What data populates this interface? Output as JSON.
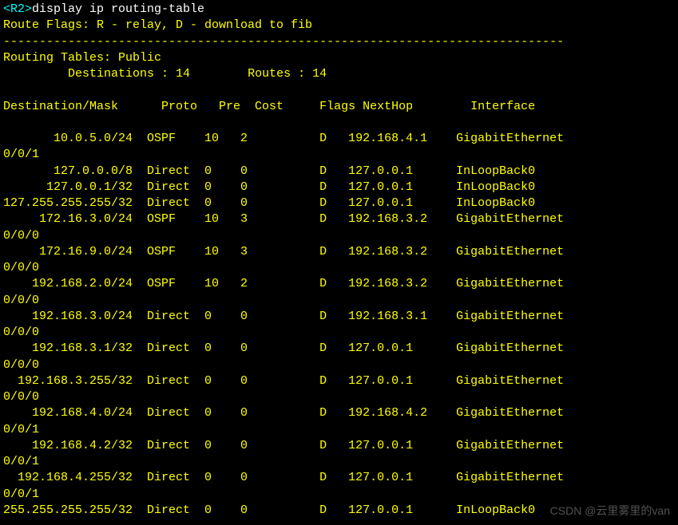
{
  "prompt": {
    "host": "<R2>",
    "command": "display ip routing-table"
  },
  "flags_legend": "Route Flags: R - relay, D - download to fib",
  "divider": "------------------------------------------------------------------------------",
  "table_title": "Routing Tables: Public",
  "summary": {
    "dest_label": "Destinations : ",
    "dest_value": "14",
    "routes_label": "Routes : ",
    "routes_value": "14"
  },
  "headers": {
    "destination": "Destination/Mask",
    "proto": "Proto",
    "pre": "Pre",
    "cost": "Cost",
    "flags": "Flags",
    "nexthop": "NextHop",
    "interface": "Interface"
  },
  "rows": [
    {
      "destination": "10.0.5.0/24",
      "proto": "OSPF",
      "pre": "10",
      "cost": "2",
      "flags": "D",
      "nexthop": "192.168.4.1",
      "interface": "GigabitEthernet",
      "interface_cont": "0/0/1"
    },
    {
      "destination": "127.0.0.0/8",
      "proto": "Direct",
      "pre": "0",
      "cost": "0",
      "flags": "D",
      "nexthop": "127.0.0.1",
      "interface": "InLoopBack0",
      "interface_cont": ""
    },
    {
      "destination": "127.0.0.1/32",
      "proto": "Direct",
      "pre": "0",
      "cost": "0",
      "flags": "D",
      "nexthop": "127.0.0.1",
      "interface": "InLoopBack0",
      "interface_cont": ""
    },
    {
      "destination": "127.255.255.255/32",
      "proto": "Direct",
      "pre": "0",
      "cost": "0",
      "flags": "D",
      "nexthop": "127.0.0.1",
      "interface": "InLoopBack0",
      "interface_cont": ""
    },
    {
      "destination": "172.16.3.0/24",
      "proto": "OSPF",
      "pre": "10",
      "cost": "3",
      "flags": "D",
      "nexthop": "192.168.3.2",
      "interface": "GigabitEthernet",
      "interface_cont": "0/0/0"
    },
    {
      "destination": "172.16.9.0/24",
      "proto": "OSPF",
      "pre": "10",
      "cost": "3",
      "flags": "D",
      "nexthop": "192.168.3.2",
      "interface": "GigabitEthernet",
      "interface_cont": "0/0/0"
    },
    {
      "destination": "192.168.2.0/24",
      "proto": "OSPF",
      "pre": "10",
      "cost": "2",
      "flags": "D",
      "nexthop": "192.168.3.2",
      "interface": "GigabitEthernet",
      "interface_cont": "0/0/0"
    },
    {
      "destination": "192.168.3.0/24",
      "proto": "Direct",
      "pre": "0",
      "cost": "0",
      "flags": "D",
      "nexthop": "192.168.3.1",
      "interface": "GigabitEthernet",
      "interface_cont": "0/0/0"
    },
    {
      "destination": "192.168.3.1/32",
      "proto": "Direct",
      "pre": "0",
      "cost": "0",
      "flags": "D",
      "nexthop": "127.0.0.1",
      "interface": "GigabitEthernet",
      "interface_cont": "0/0/0"
    },
    {
      "destination": "192.168.3.255/32",
      "proto": "Direct",
      "pre": "0",
      "cost": "0",
      "flags": "D",
      "nexthop": "127.0.0.1",
      "interface": "GigabitEthernet",
      "interface_cont": "0/0/0"
    },
    {
      "destination": "192.168.4.0/24",
      "proto": "Direct",
      "pre": "0",
      "cost": "0",
      "flags": "D",
      "nexthop": "192.168.4.2",
      "interface": "GigabitEthernet",
      "interface_cont": "0/0/1"
    },
    {
      "destination": "192.168.4.2/32",
      "proto": "Direct",
      "pre": "0",
      "cost": "0",
      "flags": "D",
      "nexthop": "127.0.0.1",
      "interface": "GigabitEthernet",
      "interface_cont": "0/0/1"
    },
    {
      "destination": "192.168.4.255/32",
      "proto": "Direct",
      "pre": "0",
      "cost": "0",
      "flags": "D",
      "nexthop": "127.0.0.1",
      "interface": "GigabitEthernet",
      "interface_cont": "0/0/1"
    },
    {
      "destination": "255.255.255.255/32",
      "proto": "Direct",
      "pre": "0",
      "cost": "0",
      "flags": "D",
      "nexthop": "127.0.0.1",
      "interface": "InLoopBack0",
      "interface_cont": ""
    }
  ],
  "watermark": "CSDN @云里雾里的van"
}
